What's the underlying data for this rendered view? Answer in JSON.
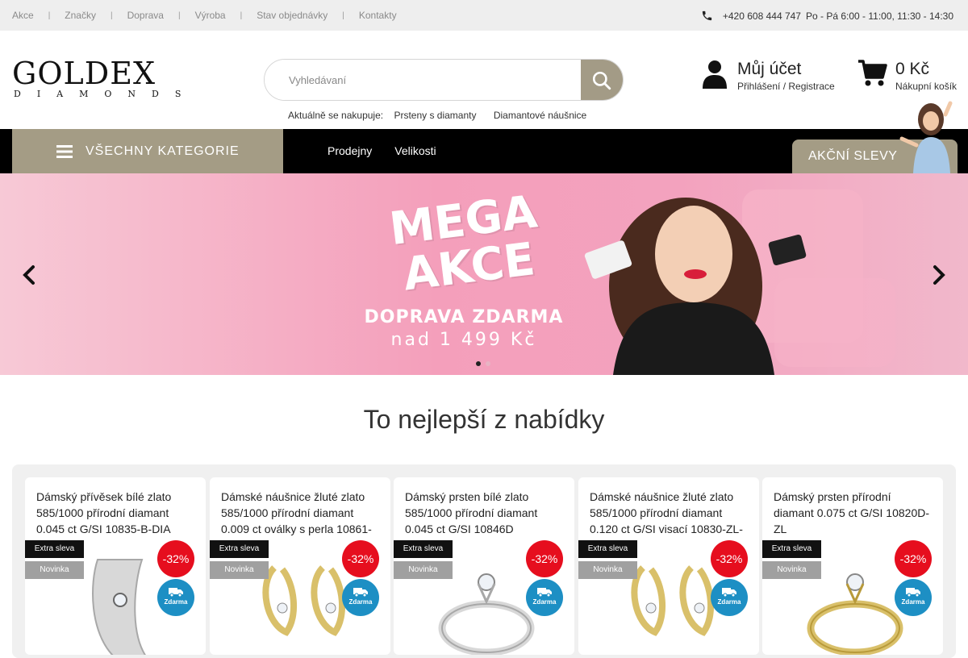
{
  "topnav": {
    "items": [
      "Akce",
      "Značky",
      "Doprava",
      "Výroba",
      "Stav objednávky",
      "Kontakty"
    ],
    "separator": "|"
  },
  "contact": {
    "phone": "+420 608 444 747",
    "hours": "Po - Pá 6:00 - 11:00, 11:30 - 14:30"
  },
  "logo": {
    "main": "GOLDEX",
    "sub": "DIAMONDS"
  },
  "search": {
    "placeholder": "Vyhledávaní",
    "trending_label": "Aktuálně se nakupuje:",
    "trending": [
      "Prsteny s diamanty",
      "Diamantové náušnice"
    ]
  },
  "account": {
    "title": "Můj účet",
    "subtitle": "Přihlášení / Registrace"
  },
  "cart": {
    "amount": "0 Kč",
    "label": "Nákupní košík"
  },
  "nav": {
    "all_categories": "VŠECHNY KATEGORIE",
    "links": [
      "Prodejny",
      "Velikosti"
    ],
    "sale": "AKČNÍ SLEVY"
  },
  "banner": {
    "headline_1": "MEGA",
    "headline_2": "AKCE",
    "line1": "DOPRAVA ZDARMA",
    "line2": "nad 1 499 Kč",
    "slides": 2,
    "active_slide": 1
  },
  "section": {
    "title": "To nejlepší z nabídky"
  },
  "products": [
    {
      "title": "Dámský přívěsek bílé zlato 585/1000 přírodní diamant 0.045 ct G/SI 10835-B-DIA",
      "extra": "Extra sleva",
      "new": "Novinka",
      "discount": "-32%",
      "free": "Zdarma",
      "metal": "white",
      "kind": "pendant"
    },
    {
      "title": "Dámské náušnice žluté zlato 585/1000 přírodní diamant 0.009 ct oválky s perla 10861-",
      "extra": "Extra sleva",
      "new": "Novinka",
      "discount": "-32%",
      "free": "Zdarma",
      "metal": "yellow",
      "kind": "earrings"
    },
    {
      "title": "Dámský prsten bílé zlato 585/1000 přírodní diamant 0.045 ct G/SI 10846D",
      "extra": "Extra sleva",
      "new": "Novinka",
      "discount": "-32%",
      "free": "Zdarma",
      "metal": "white",
      "kind": "ring"
    },
    {
      "title": "Dámské náušnice žluté zlato 585/1000 přírodní diamant 0.120 ct G/SI visací 10830-ZL-",
      "extra": "Extra sleva",
      "new": "Novinka",
      "discount": "-32%",
      "free": "Zdarma",
      "metal": "yellow",
      "kind": "earrings"
    },
    {
      "title": "Dámský prsten přírodní diamant 0.075 ct G/SI 10820D-ZL",
      "extra": "Extra sleva",
      "new": "Novinka",
      "discount": "-32%",
      "free": "Zdarma",
      "metal": "yellow",
      "kind": "ring"
    }
  ],
  "colors": {
    "accent": "#a49c85",
    "discount": "#e60e1e",
    "free_shipping": "#1d8fc4",
    "banner_pink": "#f49fbb"
  }
}
